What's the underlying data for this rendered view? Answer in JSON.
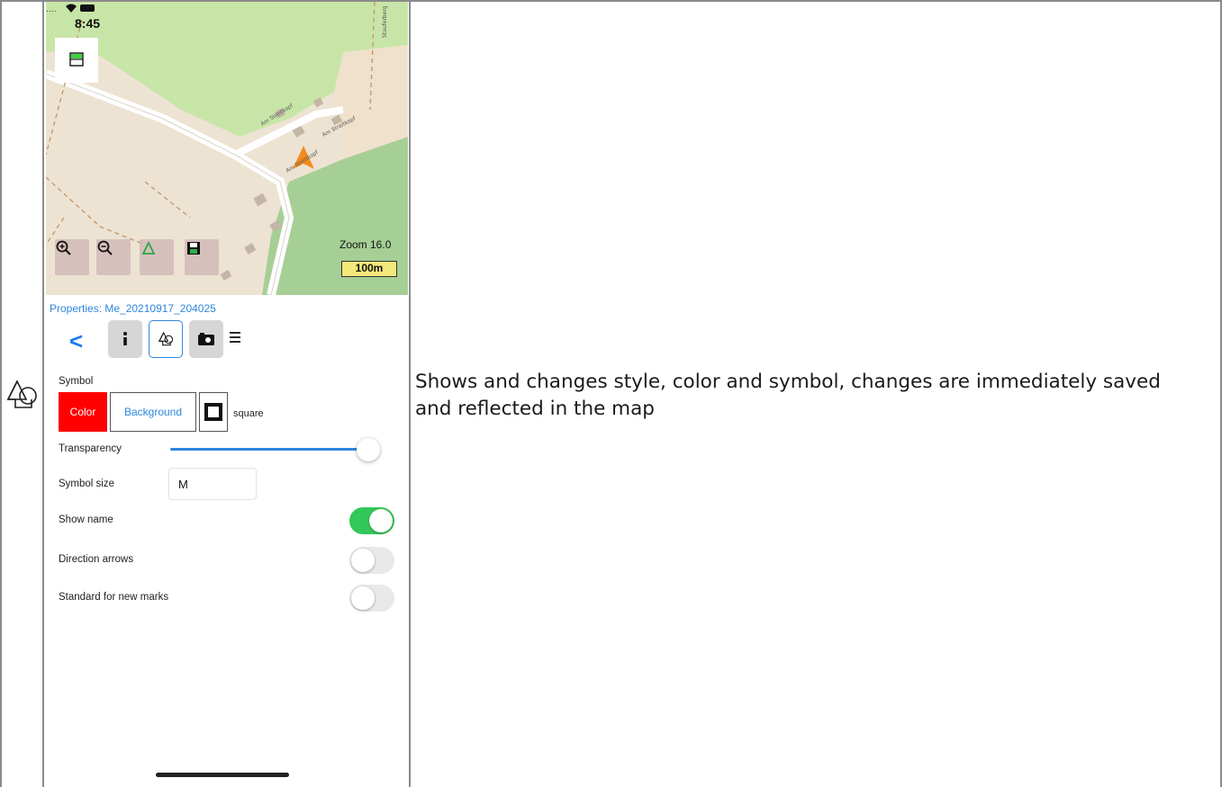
{
  "description": "Shows and changes style, color and symbol, changes are immediately saved and reflected in the map",
  "status": {
    "time": "8:45"
  },
  "map": {
    "zoom_label": "Zoom 16.0",
    "scale_label": "100m",
    "street_labels": [
      "Am Streitkopf",
      "Am Streitkopf",
      "Am Streitkopf",
      "Stauferberg"
    ]
  },
  "properties": {
    "title": "Properties:  Me_20210917_204025",
    "back": "<"
  },
  "symbol": {
    "label": "Symbol",
    "color_button": "Color",
    "background_button": "Background",
    "shape_label": "square"
  },
  "transparency": {
    "label": "Transparency",
    "value": 0.95
  },
  "symbol_size": {
    "label": "Symbol size",
    "value": "M"
  },
  "toggles": [
    {
      "label": "Show name",
      "on": true
    },
    {
      "label": "Direction arrows",
      "on": false
    },
    {
      "label": "Standard for new marks",
      "on": false
    }
  ],
  "colors": {
    "accent": "#2e86de",
    "toggle_on": "#34c759",
    "color_swatch": "#ff0000",
    "marker": "#f28c1e"
  }
}
